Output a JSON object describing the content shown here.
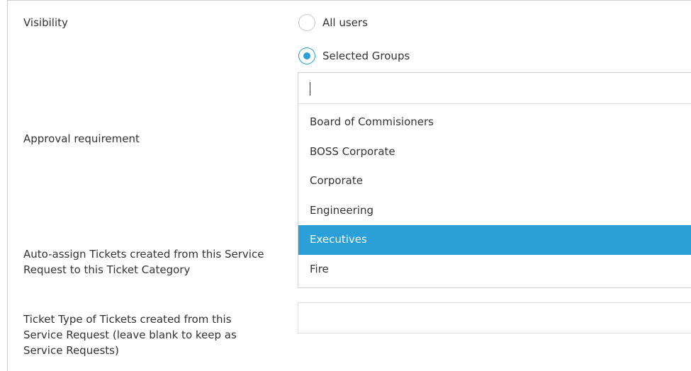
{
  "form": {
    "visibility_label": "Visibility",
    "approval_label": "Approval requirement",
    "autoassign_label": "Auto-assign Tickets created from this Service Request to this Ticket Category",
    "tickettype_label": "Ticket Type of Tickets created from this Service Request (leave blank to keep as Service Requests)"
  },
  "visibility": {
    "options": [
      {
        "label": "All users",
        "checked": false
      },
      {
        "label": "Selected Groups",
        "checked": true
      }
    ]
  },
  "group_dropdown": {
    "search_value": "",
    "options": [
      "Board of Commisioners",
      "BOSS Corporate",
      "Corporate",
      "Engineering",
      "Executives",
      "Fire"
    ],
    "highlighted": "Executives"
  },
  "ticket_type": {
    "value": ""
  },
  "colors": {
    "accent": "#2a9fd8",
    "text": "#333333",
    "border": "#d0d0d0"
  }
}
